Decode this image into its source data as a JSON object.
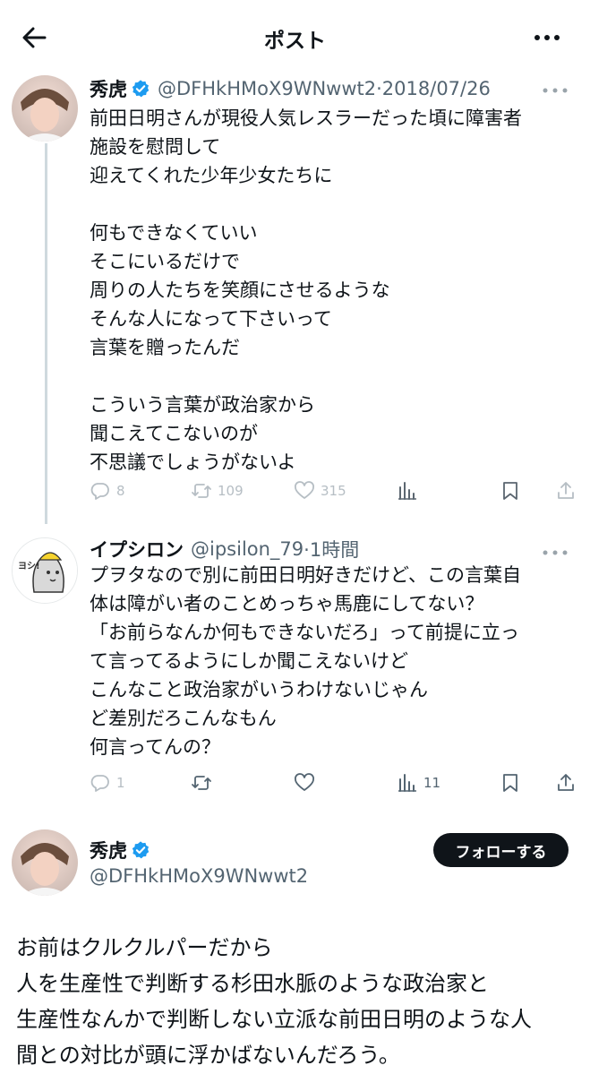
{
  "header": {
    "title": "ポスト",
    "back_icon": "arrow-left-icon",
    "more_icon": "more-horizontal-icon"
  },
  "quoted_tweet": {
    "name": "秀虎",
    "handle": "@DFHkHMoX9WNwwt2",
    "date": "·2018/07/26",
    "text": "前田日明さんが現役人気レスラーだった頃に障害者\n施設を慰問して\n迎えてくれた少年少女たちに\n\n何もできなくていい\nそこにいるだけで\n周りの人たちを笑顔にさせるような\nそんな人になって下さいって\n言葉を贈ったんだ\n\nこういう言葉が政治家から\n聞こえてこないのが\n不思議でしょうがないよ",
    "replies": "8",
    "retweets": "109",
    "likes": "315"
  },
  "reply_tweet": {
    "name": "イプシロン",
    "handle": "@ipsilon_79",
    "date": "·1時間",
    "avatar_text": "ヨシ!",
    "text": "プヲタなので別に前田日明好きだけど、この言葉自\n体は障がい者のことめっちゃ馬鹿にしてない？\n「お前らなんか何もできないだろ」って前提に立っ\nて言ってるようにしか聞こえないけど\nこんなこと政治家がいうわけないじゃん\nど差別だろこんなもん\n何言ってんの？",
    "replies": "1",
    "views": "11"
  },
  "main_tweet": {
    "name": "秀虎",
    "handle": "@DFHkHMoX9WNwwt2",
    "follow_label": "フォローする",
    "text": "お前はクルクルパーだから\n人を生産性で判断する杉田水脈のような政治家と\n生産性なんかで判断しない立派な前田日明のような人\n間との対比が頭に浮かばないんだろう。"
  },
  "colors": {
    "verified": "#1d9bf0",
    "text": "#0f1419",
    "secondary": "#536471",
    "icon_gray": "#b6bec4",
    "follow_bg": "#0f1419"
  }
}
